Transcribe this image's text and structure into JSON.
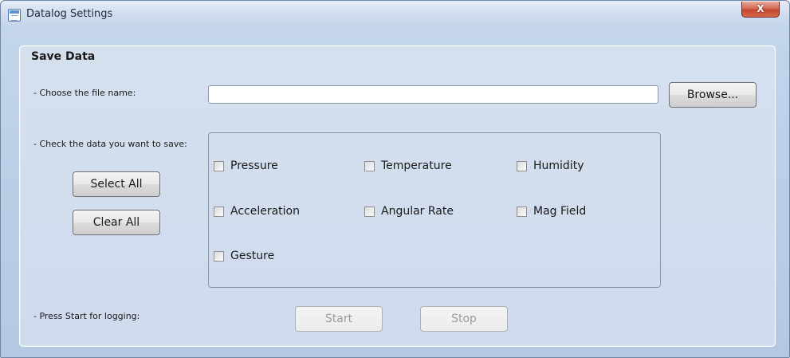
{
  "window": {
    "title": "Datalog Settings",
    "close_label": "X"
  },
  "group": {
    "title": "Save Data"
  },
  "file": {
    "label": "- Choose the file name:",
    "value": "",
    "browse_label": "Browse..."
  },
  "selection": {
    "label": "- Check the data you want to save:",
    "select_all_label": "Select All",
    "clear_all_label": "Clear All",
    "items": [
      {
        "label": "Pressure",
        "checked": false
      },
      {
        "label": "Temperature",
        "checked": false
      },
      {
        "label": "Humidity",
        "checked": false
      },
      {
        "label": "Acceleration",
        "checked": false
      },
      {
        "label": "Angular Rate",
        "checked": false
      },
      {
        "label": "Mag Field",
        "checked": false
      },
      {
        "label": "Gesture",
        "checked": false
      }
    ]
  },
  "logging": {
    "label": "- Press Start for logging:",
    "start_label": "Start",
    "stop_label": "Stop",
    "start_enabled": false,
    "stop_enabled": false
  }
}
